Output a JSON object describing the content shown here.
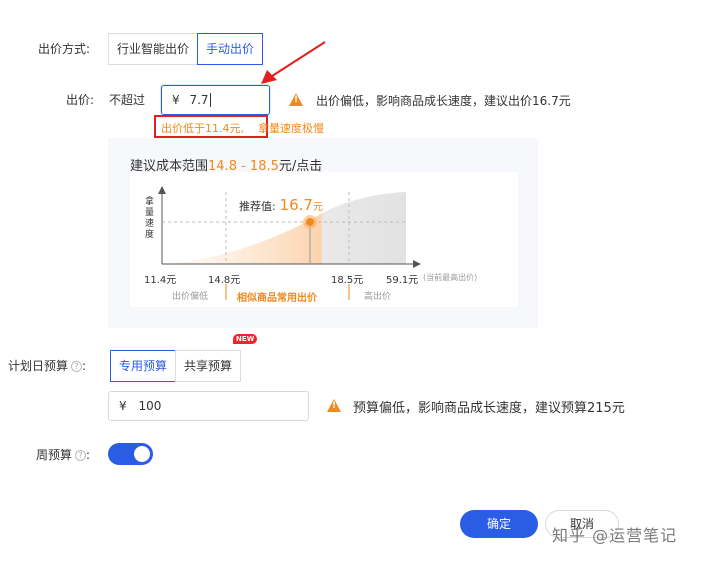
{
  "bid_method": {
    "label": "出价方式:",
    "options": [
      "行业智能出价",
      "手动出价"
    ]
  },
  "bid": {
    "label": "出价:",
    "prefix": "不超过",
    "currency": "¥",
    "value": "7.7",
    "hint": "出价偏低，影响商品成长速度，建议出价16.7元",
    "error_red": "出价低于11.4元,",
    "error_orange": "拿量速度极慢"
  },
  "suggest": {
    "title_prefix": "建议成本范围",
    "range": "14.8 - 18.5",
    "title_suffix": "元/点击",
    "y_axis": "拿量速度",
    "recommend_label": "推荐值:",
    "recommend_value": "16.7",
    "recommend_unit": "元",
    "ticks": [
      "11.4元",
      "14.8元",
      "18.5元",
      "59.1元"
    ],
    "tick_note": "(当前最高出价)",
    "zone_low": "出价偏低",
    "zone_mid": "相似商品常用出价",
    "zone_high": "高出价"
  },
  "daily_budget": {
    "label": "计划日预算",
    "options": [
      "专用预算",
      "共享预算"
    ],
    "new_badge": "NEW",
    "currency": "¥",
    "value": "100",
    "hint": "预算偏低，影响商品成长速度，建议预算215元"
  },
  "weekly_budget": {
    "label": "周预算",
    "enabled": true
  },
  "actions": {
    "confirm": "确定",
    "cancel": "取消"
  },
  "watermark": "知乎 @运营笔记",
  "colors": {
    "primary": "#2b5ce6",
    "warning": "#f08a1c",
    "error": "#e02020"
  }
}
